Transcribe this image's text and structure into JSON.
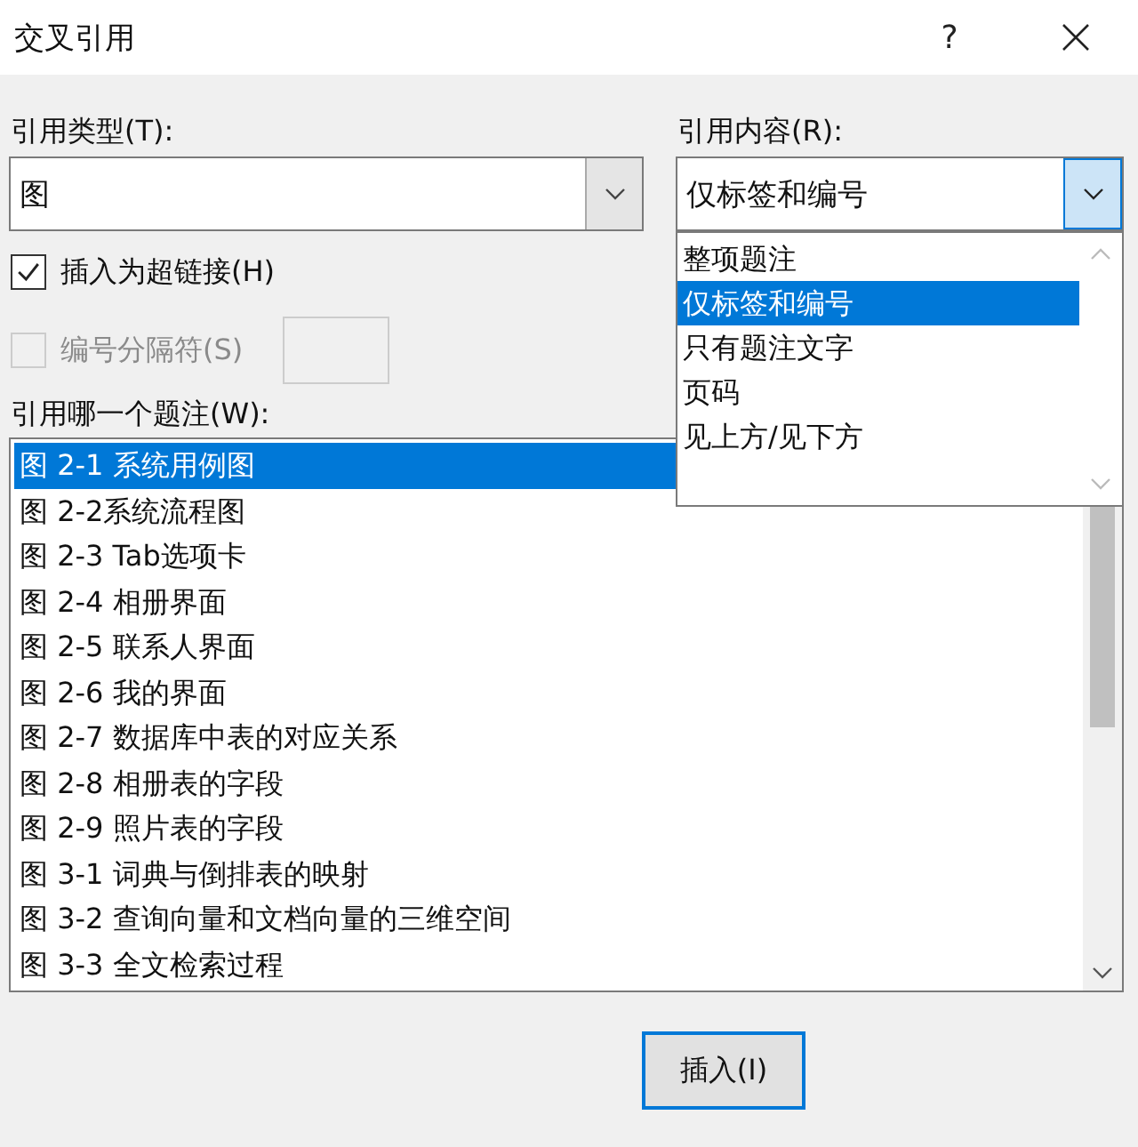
{
  "window": {
    "title": "交叉引用",
    "help": "?"
  },
  "reference_type": {
    "label": "引用类型(T):",
    "value": "图"
  },
  "reference_content": {
    "label": "引用内容(R):",
    "value": "仅标签和编号",
    "expanded": true,
    "options": [
      {
        "label": "整项题注",
        "selected": false
      },
      {
        "label": "仅标签和编号",
        "selected": true
      },
      {
        "label": "只有题注文字",
        "selected": false
      },
      {
        "label": "页码",
        "selected": false
      },
      {
        "label": "见上方/见下方",
        "selected": false
      }
    ]
  },
  "insert_as_hyperlink": {
    "label": "插入为超链接(H)",
    "checked": true,
    "disabled": false
  },
  "number_separator": {
    "label": "编号分隔符(S)",
    "checked": false,
    "disabled": true
  },
  "caption_list": {
    "label": "引用哪一个题注(W):",
    "items": [
      {
        "label": "图 2-1 系统用例图",
        "selected": true
      },
      {
        "label": "图 2-2系统流程图",
        "selected": false
      },
      {
        "label": "图 2-3 Tab选项卡",
        "selected": false
      },
      {
        "label": "图 2-4 相册界面",
        "selected": false
      },
      {
        "label": "图 2-5 联系人界面",
        "selected": false
      },
      {
        "label": "图 2-6 我的界面",
        "selected": false
      },
      {
        "label": "图 2-7 数据库中表的对应关系",
        "selected": false
      },
      {
        "label": "图 2-8 相册表的字段",
        "selected": false
      },
      {
        "label": "图 2-9 照片表的字段",
        "selected": false
      },
      {
        "label": "图 3-1 词典与倒排表的映射",
        "selected": false
      },
      {
        "label": "图 3-2 查询向量和文档向量的三维空间",
        "selected": false
      },
      {
        "label": "图 3-3 全文检索过程",
        "selected": false
      }
    ]
  },
  "buttons": [
    {
      "label": "插入(I)",
      "default": true
    }
  ]
}
